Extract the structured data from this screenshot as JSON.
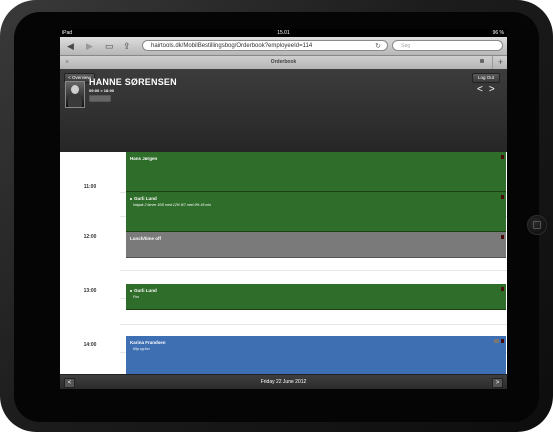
{
  "status_bar": {
    "device": "iPad",
    "time": "15.01",
    "battery": "96 %"
  },
  "browser": {
    "url": "hairtools.dk/MobilBestillingsbog/Orderbook?employeeId=114",
    "search_placeholder": "Søg",
    "tab_title": "Orderbook",
    "new_tab": "+",
    "close_tab": "×"
  },
  "header": {
    "overview_label": "< Overview",
    "logout_label": "Log Out",
    "employee_name": "HANNE SØRENSEN",
    "hours": "09:00 > 18:00",
    "prev_arrow": "<",
    "next_arrow": ">"
  },
  "time_labels": [
    "11:00",
    "12:00",
    "13:00",
    "14:00"
  ],
  "events": [
    {
      "title": "Hans Jørgen",
      "subtitle": "",
      "color": "#2f6e2a"
    },
    {
      "title": "Gurli Lund",
      "subtitle": "Indpak 2 farver 10/0 med 12% 8/7 med 9% 45 min",
      "color": "#2f6e2a"
    },
    {
      "title": "Lunch/time off",
      "subtitle": "",
      "color": "#7a7a7a"
    },
    {
      "title": "Gurli Lund",
      "subtitle": "Fon",
      "color": "#2f6e2a"
    },
    {
      "title": "Karina Frandsen",
      "subtitle": "Klip og fon",
      "color": "#3f6fb3"
    }
  ],
  "footer": {
    "date": "Friday 22 June 2012",
    "prev": "<",
    "next": ">"
  }
}
